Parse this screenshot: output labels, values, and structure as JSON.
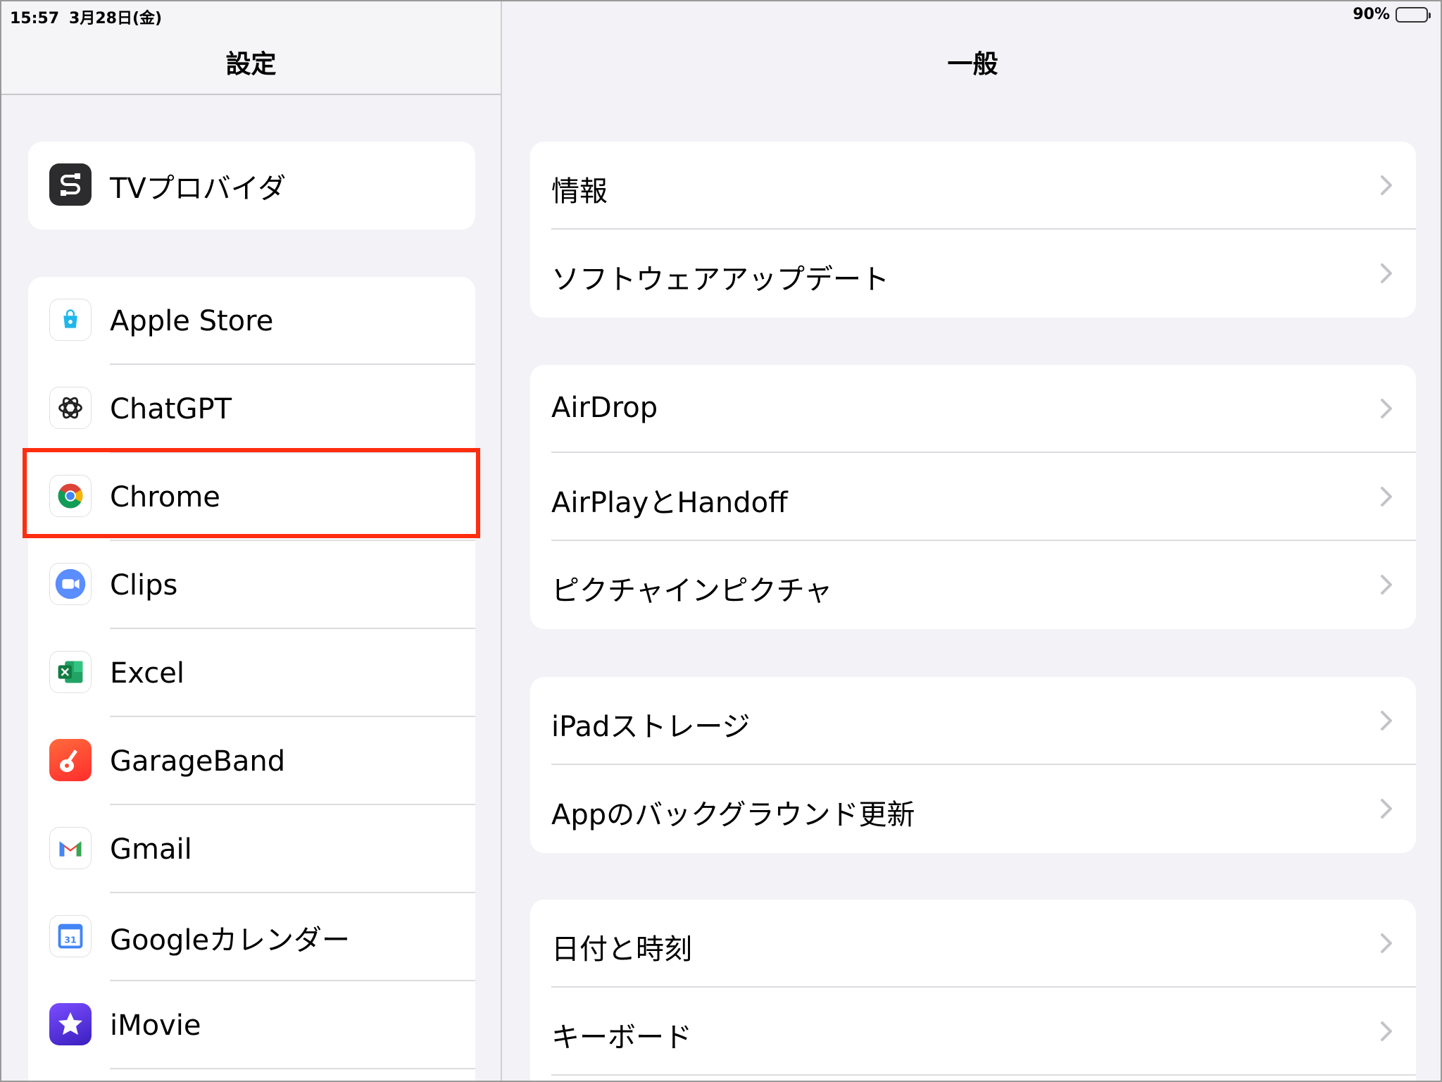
{
  "status": {
    "time": "15:57",
    "date": "3月28日(金)",
    "battery": "90%"
  },
  "sidebar": {
    "title": "設定",
    "groups": [
      {
        "items": [
          {
            "label": "TVプロバイダ",
            "icon": "tv-provider-icon"
          }
        ]
      },
      {
        "items": [
          {
            "label": "Apple Store",
            "icon": "apple-store-icon"
          },
          {
            "label": "ChatGPT",
            "icon": "chatgpt-icon"
          },
          {
            "label": "Chrome",
            "icon": "chrome-icon"
          },
          {
            "label": "Clips",
            "icon": "clips-icon"
          },
          {
            "label": "Excel",
            "icon": "excel-icon"
          },
          {
            "label": "GarageBand",
            "icon": "garageband-icon"
          },
          {
            "label": "Gmail",
            "icon": "gmail-icon"
          },
          {
            "label": "Googleカレンダー",
            "icon": "google-calendar-icon"
          },
          {
            "label": "iMovie",
            "icon": "imovie-icon"
          }
        ]
      }
    ]
  },
  "calendar_day": "31",
  "main": {
    "title": "一般",
    "groups": [
      {
        "items": [
          {
            "label": "情報"
          },
          {
            "label": "ソフトウェアアップデート"
          }
        ]
      },
      {
        "items": [
          {
            "label": "AirDrop"
          },
          {
            "label": "AirPlayとHandoff"
          },
          {
            "label": "ピクチャインピクチャ"
          }
        ]
      },
      {
        "items": [
          {
            "label": "iPadストレージ"
          },
          {
            "label": "Appのバックグラウンド更新"
          }
        ]
      },
      {
        "items": [
          {
            "label": "日付と時刻"
          },
          {
            "label": "キーボード"
          }
        ]
      }
    ]
  },
  "colors": {
    "highlight": "#ff2d0f",
    "background": "#f2f2f7"
  }
}
